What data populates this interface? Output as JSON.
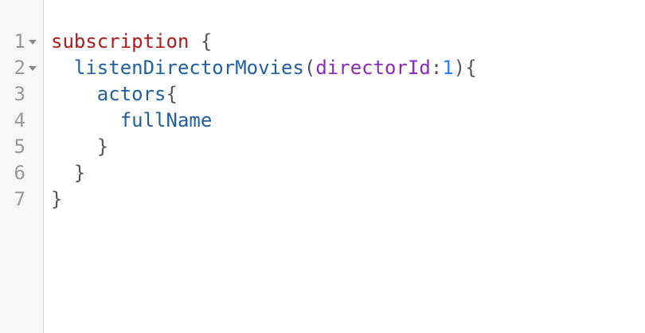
{
  "editor": {
    "lines": [
      {
        "number": "1",
        "foldable": true,
        "indent": "",
        "tokens": [
          {
            "cls": "kw",
            "text": "subscription"
          },
          {
            "cls": "punct",
            "text": " {"
          }
        ]
      },
      {
        "number": "2",
        "foldable": true,
        "indent": "  ",
        "tokens": [
          {
            "cls": "field",
            "text": "listenDirectorMovies"
          },
          {
            "cls": "punct",
            "text": "("
          },
          {
            "cls": "arg",
            "text": "directorId"
          },
          {
            "cls": "punct",
            "text": ":"
          },
          {
            "cls": "num",
            "text": "1"
          },
          {
            "cls": "punct",
            "text": "){"
          }
        ]
      },
      {
        "number": "3",
        "foldable": false,
        "indent": "    ",
        "tokens": [
          {
            "cls": "field",
            "text": "actors"
          },
          {
            "cls": "punct",
            "text": "{"
          }
        ]
      },
      {
        "number": "4",
        "foldable": false,
        "indent": "      ",
        "tokens": [
          {
            "cls": "field",
            "text": "fullName"
          }
        ]
      },
      {
        "number": "5",
        "foldable": false,
        "indent": "    ",
        "tokens": [
          {
            "cls": "punct",
            "text": "}"
          }
        ]
      },
      {
        "number": "6",
        "foldable": false,
        "indent": "  ",
        "tokens": [
          {
            "cls": "punct",
            "text": "}"
          }
        ]
      },
      {
        "number": "7",
        "foldable": false,
        "indent": "",
        "tokens": [
          {
            "cls": "punct",
            "text": "}"
          }
        ]
      }
    ],
    "fold_icon": "chevron-down-icon"
  }
}
